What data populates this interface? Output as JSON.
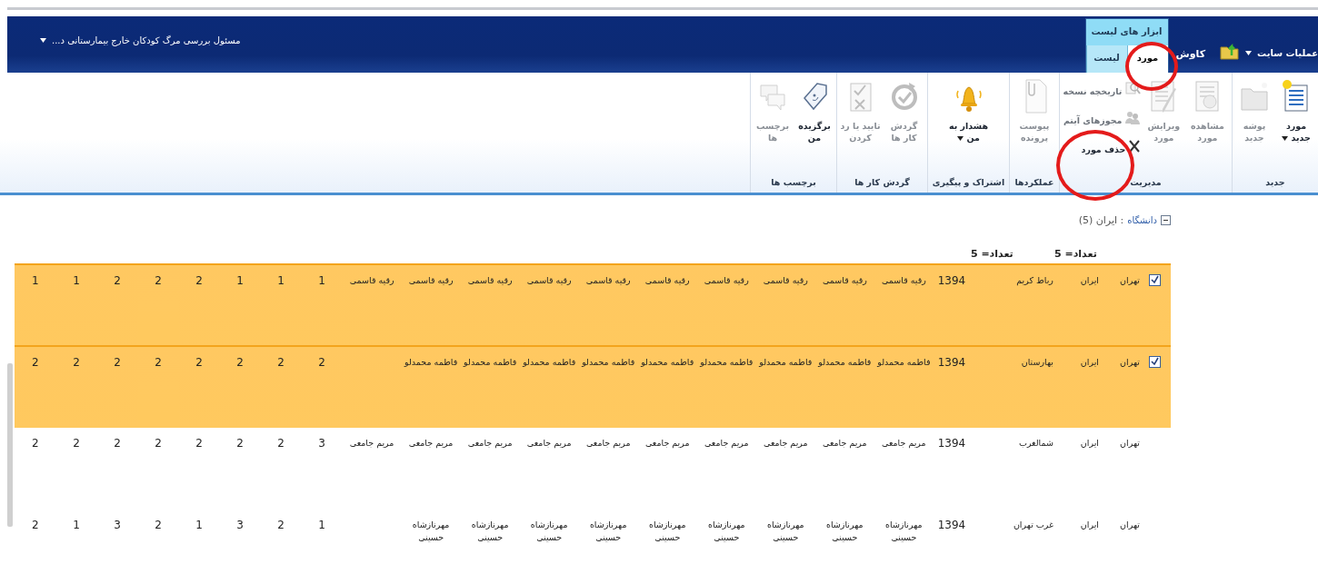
{
  "top_bar": {
    "site_actions": "عملیات سایت",
    "browse_tab": {
      "label": "کاوش",
      "selected": false
    },
    "context_group": "ابزار های لیست",
    "tabs": [
      {
        "label": "مورد",
        "selected": true
      },
      {
        "label": "لیست",
        "selected": false
      }
    ],
    "breadcrumb": "مسئول بررسی مرگ کودکان خارج بیمارستانی د..."
  },
  "ribbon": {
    "groups": [
      {
        "label": "جدید",
        "buttons": [
          {
            "kind": "large",
            "label": "مورد جدید",
            "dropdown": true,
            "disabled": false
          },
          {
            "kind": "large",
            "label": "پوشه جدید",
            "dropdown": false,
            "disabled": true
          }
        ]
      },
      {
        "label": "مدیریت",
        "buttons": [
          {
            "kind": "large",
            "label": "مشاهده مورد",
            "dropdown": false,
            "disabled": true
          },
          {
            "kind": "large",
            "label": "ویرایش مورد",
            "dropdown": false,
            "disabled": true
          },
          {
            "kind": "small",
            "label": "تاریخچه نسخه",
            "dropdown": false,
            "disabled": true
          },
          {
            "kind": "small",
            "label": "مجوزهای آیتم",
            "dropdown": false,
            "disabled": true
          },
          {
            "kind": "small",
            "label": "حذف مورد",
            "dropdown": false,
            "disabled": false
          }
        ]
      },
      {
        "label": "عملکردها",
        "buttons": [
          {
            "kind": "large",
            "label": "پیوست پرونده",
            "dropdown": false,
            "disabled": true
          }
        ]
      },
      {
        "label": "اشتراک و پیگیری",
        "buttons": [
          {
            "kind": "large",
            "label": "هشدار به من",
            "dropdown": true,
            "disabled": false
          }
        ]
      },
      {
        "label": "گردش کار ها",
        "buttons": [
          {
            "kind": "large",
            "label": "گردش کار ها",
            "dropdown": false,
            "disabled": true
          },
          {
            "kind": "large",
            "label": "تایید یا رد کردن",
            "dropdown": false,
            "disabled": true
          }
        ]
      },
      {
        "label": "برچسب ها",
        "buttons": [
          {
            "kind": "large",
            "label": "برگزیده من",
            "dropdown": false,
            "disabled": false
          },
          {
            "kind": "large",
            "label": "برچسب ها",
            "dropdown": false,
            "disabled": true
          }
        ]
      }
    ]
  },
  "group_header": {
    "expanded": true,
    "label": "دانشگاه",
    "value": ": ایران (5)"
  },
  "totals": [
    "تعداد= 5",
    "تعداد= 5"
  ],
  "rows": [
    {
      "selected": true,
      "city": "تهران",
      "country": "ایران",
      "site": "رباط کریم",
      "year": "1394",
      "names": [
        "رقیه قاسمی",
        "رقیه قاسمی",
        "رقیه قاسمی",
        "رقیه قاسمی",
        "رقیه قاسمی",
        "رقیه قاسمی",
        "رقیه قاسمی",
        "رقیه قاسمی",
        "رقیه قاسمی",
        "رقیه قاسمی"
      ],
      "numbers": [
        "1",
        "1",
        "1",
        "2",
        "2",
        "2",
        "1",
        "1"
      ]
    },
    {
      "selected": true,
      "city": "تهران",
      "country": "ایران",
      "site": "بهارستان",
      "year": "1394",
      "names": [
        "فاطمه محمدلو",
        "فاطمه محمدلو",
        "فاطمه محمدلو",
        "فاطمه محمدلو",
        "فاطمه محمدلو",
        "فاطمه محمدلو",
        "فاطمه محمدلو",
        "فاطمه محمدلو",
        "فاطمه محمدلو"
      ],
      "numbers": [
        "2",
        "2",
        "2",
        "2",
        "2",
        "2",
        "2",
        "2"
      ]
    },
    {
      "selected": false,
      "city": "تهران",
      "country": "ایران",
      "site": "شمالغرب",
      "year": "1394",
      "names": [
        "مریم جامعی",
        "مریم جامعی",
        "مریم جامعی",
        "مریم جامعی",
        "مریم جامعی",
        "مریم جامعی",
        "مریم جامعی",
        "مریم جامعی",
        "مریم جامعی",
        "مریم جامعی"
      ],
      "numbers": [
        "3",
        "2",
        "2",
        "2",
        "2",
        "2",
        "2",
        "2"
      ]
    },
    {
      "selected": false,
      "city": "تهران",
      "country": "ایران",
      "site": "غرب تهران",
      "year": "1394",
      "names": [
        "مهرنازشاه حسینی",
        "مهرنازشاه حسینی",
        "مهرنازشاه حسینی",
        "مهرنازشاه حسینی",
        "مهرنازشاه حسینی",
        "مهرنازشاه حسینی",
        "مهرنازشاه حسینی",
        "مهرنازشاه حسینی",
        "مهرنازشاه حسینی"
      ],
      "numbers": [
        "1",
        "2",
        "3",
        "1",
        "2",
        "3",
        "1",
        "2"
      ]
    }
  ]
}
